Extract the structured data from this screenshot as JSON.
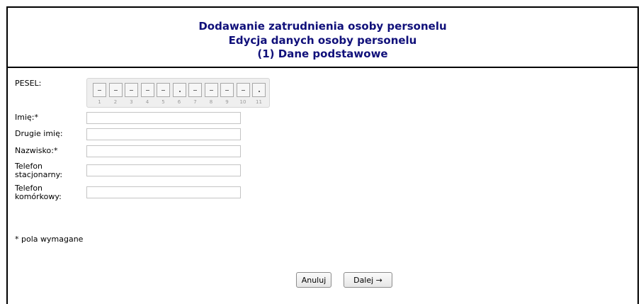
{
  "header": {
    "title_line1": "Dodawanie zatrudnienia osoby personelu",
    "title_line2": "Edycja danych osoby personelu",
    "title_line3": "(1) Dane podstawowe"
  },
  "form": {
    "pesel_label": "PESEL:",
    "pesel_digit_numbers": [
      "1",
      "2",
      "3",
      "4",
      "5",
      "6",
      "7",
      "8",
      "9",
      "10",
      "11"
    ],
    "first_name_label": "Imię:*",
    "first_name_value": "",
    "second_name_label": "Drugie imię:",
    "second_name_value": "",
    "surname_label": "Nazwisko:*",
    "surname_value": "",
    "phone_label_line1": "Telefon",
    "phone_label_line2": "stacjonarny:",
    "phone_value": "",
    "mobile_label_line1": "Telefon",
    "mobile_label_line2": "komórkowy:",
    "mobile_value": ""
  },
  "footer": {
    "required_note": "* pola wymagane",
    "cancel_label": "Anuluj",
    "next_label": "Dalej →"
  },
  "colors": {
    "title": "#10107a",
    "border": "#000000"
  }
}
